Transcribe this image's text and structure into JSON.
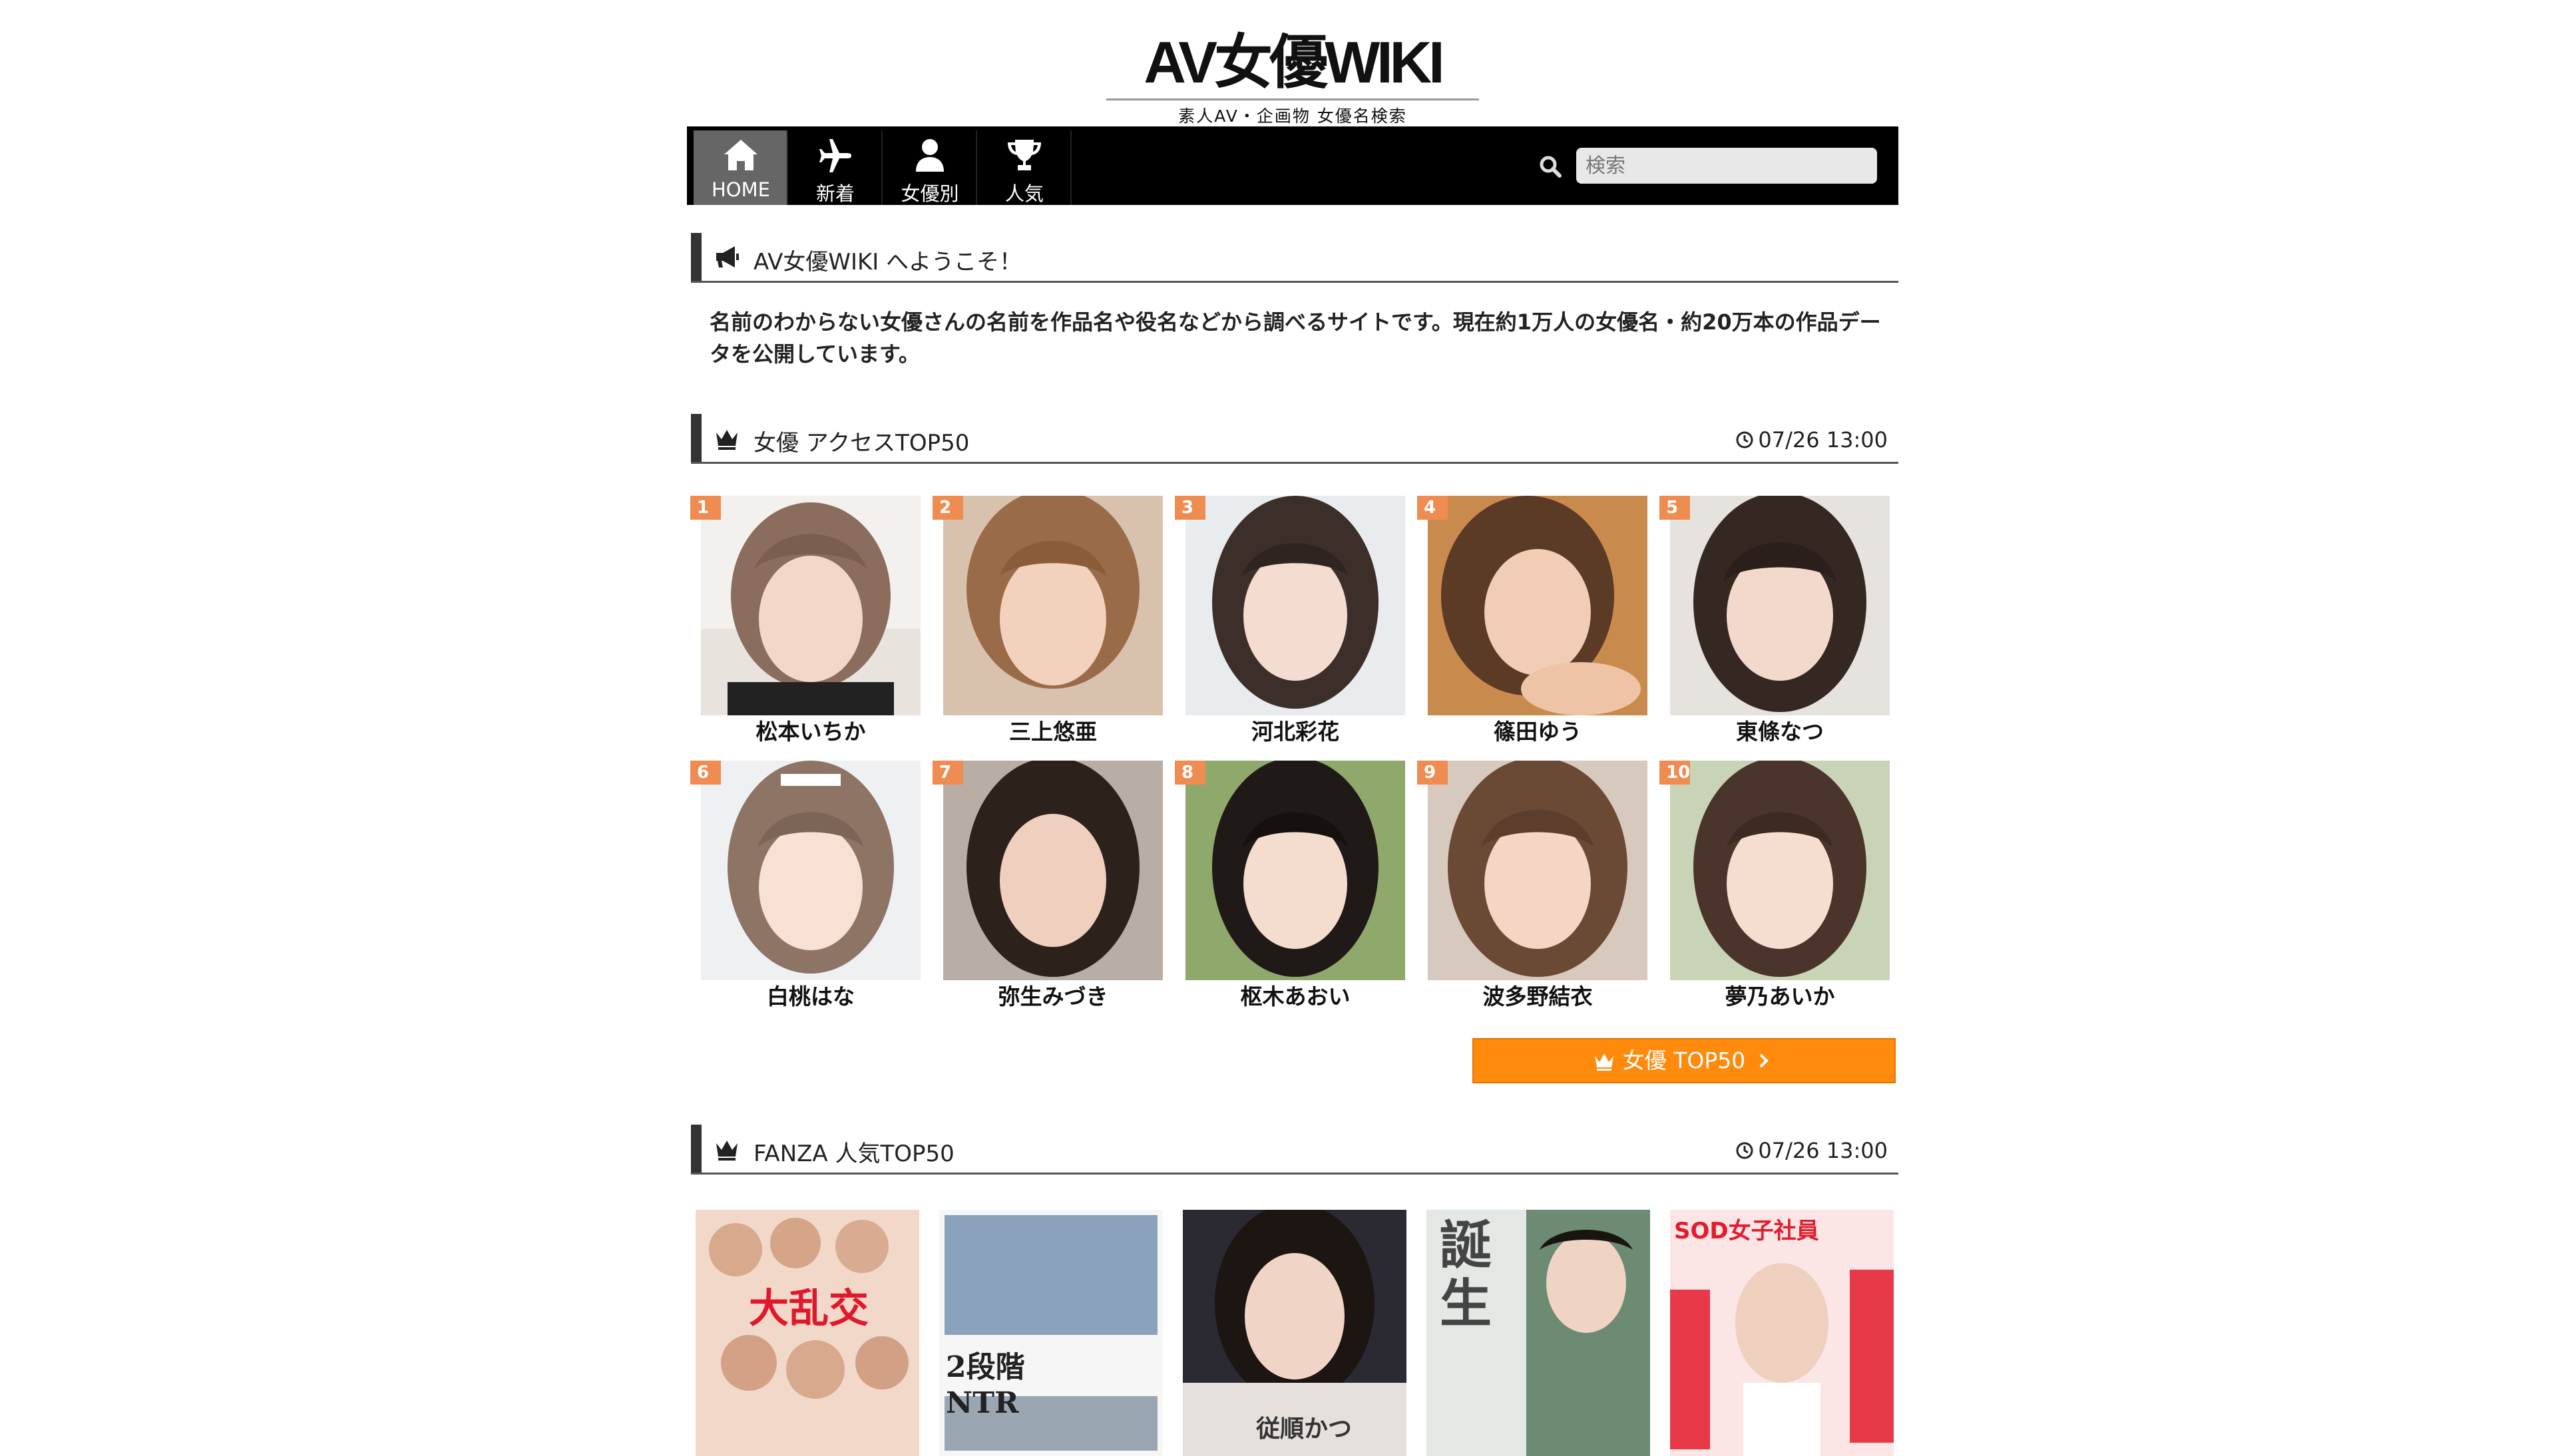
{
  "logo": {
    "title": "AV女優WIKI",
    "subtitle": "素人AV・企画物 女優名検索"
  },
  "nav": [
    {
      "label": "HOME",
      "icon": "home-icon"
    },
    {
      "label": "新着",
      "icon": "plane-icon"
    },
    {
      "label": "女優別",
      "icon": "person-icon"
    },
    {
      "label": "人気",
      "icon": "trophy-icon"
    }
  ],
  "search": {
    "placeholder": "検索"
  },
  "welcome": {
    "title": "AV女優WIKI へようこそ！",
    "text": "名前のわからない女優さんの名前を作品名や役名などから調べるサイトです。現在約1万人の女優名・約20万本の作品データを公開しています。"
  },
  "actress_top": {
    "title": "女優 アクセスTOP50",
    "time": "07/26 13:00",
    "button": "女優 TOP50",
    "items": [
      {
        "rank": "1",
        "name": "松本いちか"
      },
      {
        "rank": "2",
        "name": "三上悠亜"
      },
      {
        "rank": "3",
        "name": "河北彩花"
      },
      {
        "rank": "4",
        "name": "篠田ゆう"
      },
      {
        "rank": "5",
        "name": "東條なつ"
      },
      {
        "rank": "6",
        "name": "白桃はな"
      },
      {
        "rank": "7",
        "name": "弥生みづき"
      },
      {
        "rank": "8",
        "name": "枢木あおい"
      },
      {
        "rank": "9",
        "name": "波多野結衣"
      },
      {
        "rank": "10",
        "name": "夢乃あいか"
      }
    ]
  },
  "fanza_top": {
    "title": "FANZA 人気TOP50",
    "time": "07/26 13:00",
    "packages": [
      {
        "text": "大乱交"
      },
      {
        "text": "2段階 NTR"
      },
      {
        "text": "従順かつ"
      },
      {
        "text": "誕生"
      },
      {
        "text": "SOD女子社員"
      }
    ]
  },
  "colors": {
    "accent": "#ff8a0c",
    "rank_badge": "#ef8c52",
    "nav_bg": "#000000",
    "nav_active": "#666666"
  }
}
